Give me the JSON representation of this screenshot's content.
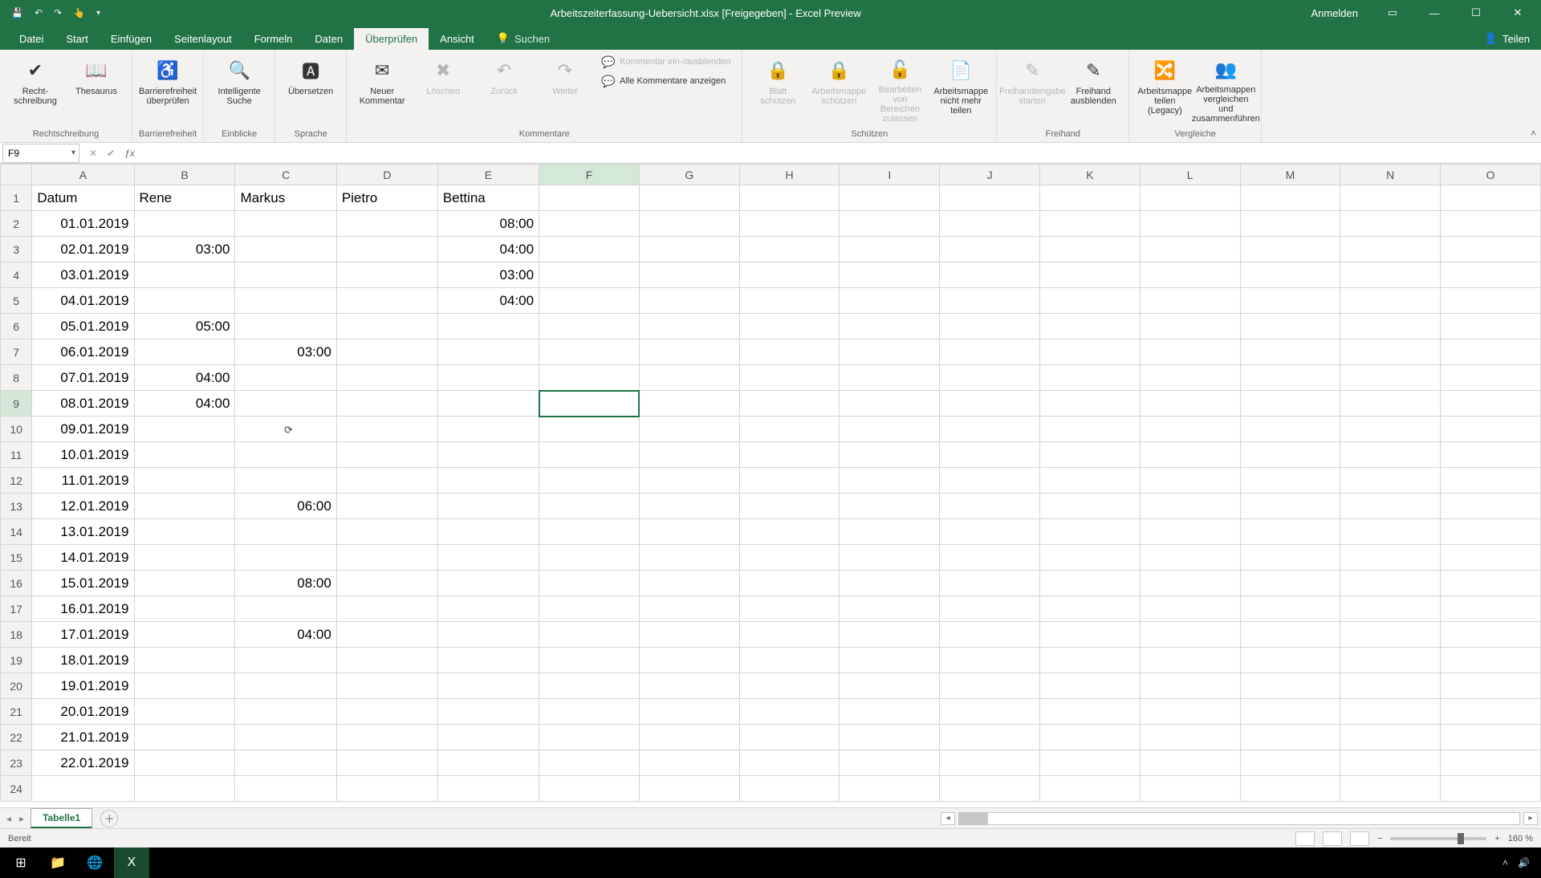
{
  "title": {
    "doc": "Arbeitszeiterfassung-Uebersicht.xlsx  [Freigegeben]  -  Excel Preview",
    "signin": "Anmelden"
  },
  "tabs": [
    "Datei",
    "Start",
    "Einfügen",
    "Seitenlayout",
    "Formeln",
    "Daten",
    "Überprüfen",
    "Ansicht"
  ],
  "activeTab": 6,
  "search": "Suchen",
  "share": "Teilen",
  "ribbon": {
    "groups": [
      {
        "label": "Rechtschreibung",
        "items": [
          {
            "icon": "✔",
            "text": "Recht-\nschreibung"
          },
          {
            "icon": "📖",
            "text": "Thesaurus"
          }
        ]
      },
      {
        "label": "Barrierefreiheit",
        "items": [
          {
            "icon": "♿",
            "text": "Barrierefreiheit\nüberprüfen"
          }
        ]
      },
      {
        "label": "Einblicke",
        "items": [
          {
            "icon": "🔍",
            "text": "Intelligente\nSuche"
          }
        ]
      },
      {
        "label": "Sprache",
        "items": [
          {
            "icon": "🅰",
            "text": "Übersetzen"
          }
        ]
      },
      {
        "label": "Kommentare",
        "items": [
          {
            "icon": "✉",
            "text": "Neuer\nKommentar"
          },
          {
            "icon": "✖",
            "text": "Löschen",
            "disabled": true
          },
          {
            "icon": "↶",
            "text": "Zurück",
            "disabled": true
          },
          {
            "icon": "↷",
            "text": "Weiter",
            "disabled": true
          }
        ],
        "stack": [
          {
            "icon": "💬",
            "text": "Kommentar ein-/ausblenden",
            "disabled": true
          },
          {
            "icon": "💬",
            "text": "Alle Kommentare anzeigen"
          }
        ]
      },
      {
        "label": "Schützen",
        "items": [
          {
            "icon": "🔒",
            "text": "Blatt\nschützen",
            "disabled": true
          },
          {
            "icon": "🔒",
            "text": "Arbeitsmappe\nschützen",
            "disabled": true
          },
          {
            "icon": "🔓",
            "text": "Bearbeiten von\nBereichen zulassen",
            "disabled": true
          },
          {
            "icon": "📄",
            "text": "Arbeitsmappe\nnicht mehr teilen"
          }
        ]
      },
      {
        "label": "Freihand",
        "items": [
          {
            "icon": "✎",
            "text": "Freihandeingabe\nstarten",
            "disabled": true
          },
          {
            "icon": "✎",
            "text": "Freihand\nausblenden"
          }
        ]
      },
      {
        "label": "Vergleiche",
        "items": [
          {
            "icon": "🔀",
            "text": "Arbeitsmappe\nteilen (Legacy)"
          },
          {
            "icon": "👥",
            "text": "Arbeitsmappen vergleichen\nund zusammenführen"
          }
        ]
      }
    ]
  },
  "namebox": "F9",
  "formula": "",
  "columns": [
    "A",
    "B",
    "C",
    "D",
    "E",
    "F",
    "G",
    "H",
    "I",
    "J",
    "K",
    "L",
    "M",
    "N",
    "O"
  ],
  "header": [
    "Datum",
    "Rene",
    "Markus",
    "Pietro",
    "Bettina",
    "",
    "",
    "",
    "",
    "",
    "",
    "",
    "",
    "",
    ""
  ],
  "rows": [
    [
      "01.01.2019",
      "",
      "",
      "",
      "08:00"
    ],
    [
      "02.01.2019",
      "03:00",
      "",
      "",
      "04:00"
    ],
    [
      "03.01.2019",
      "",
      "",
      "",
      "03:00"
    ],
    [
      "04.01.2019",
      "",
      "",
      "",
      "04:00"
    ],
    [
      "05.01.2019",
      "05:00",
      "",
      "",
      ""
    ],
    [
      "06.01.2019",
      "",
      "03:00",
      "",
      ""
    ],
    [
      "07.01.2019",
      "04:00",
      "",
      "",
      ""
    ],
    [
      "08.01.2019",
      "04:00",
      "",
      "",
      ""
    ],
    [
      "09.01.2019",
      "",
      "",
      "",
      ""
    ],
    [
      "10.01.2019",
      "",
      "",
      "",
      ""
    ],
    [
      "11.01.2019",
      "",
      "",
      "",
      ""
    ],
    [
      "12.01.2019",
      "",
      "06:00",
      "",
      ""
    ],
    [
      "13.01.2019",
      "",
      "",
      "",
      ""
    ],
    [
      "14.01.2019",
      "",
      "",
      "",
      ""
    ],
    [
      "15.01.2019",
      "",
      "08:00",
      "",
      ""
    ],
    [
      "16.01.2019",
      "",
      "",
      "",
      ""
    ],
    [
      "17.01.2019",
      "",
      "04:00",
      "",
      ""
    ],
    [
      "18.01.2019",
      "",
      "",
      "",
      ""
    ],
    [
      "19.01.2019",
      "",
      "",
      "",
      ""
    ],
    [
      "20.01.2019",
      "",
      "",
      "",
      ""
    ],
    [
      "21.01.2019",
      "",
      "",
      "",
      ""
    ],
    [
      "22.01.2019",
      "",
      "",
      "",
      ""
    ],
    [
      "",
      "",
      "",
      "",
      ""
    ]
  ],
  "selected": {
    "row": 9,
    "col": 6
  },
  "cursor": {
    "row": 10,
    "col": 3,
    "glyph": "⟳"
  },
  "sheetTab": "Tabelle1",
  "status": {
    "ready": "Bereit",
    "zoom": "160 %"
  }
}
